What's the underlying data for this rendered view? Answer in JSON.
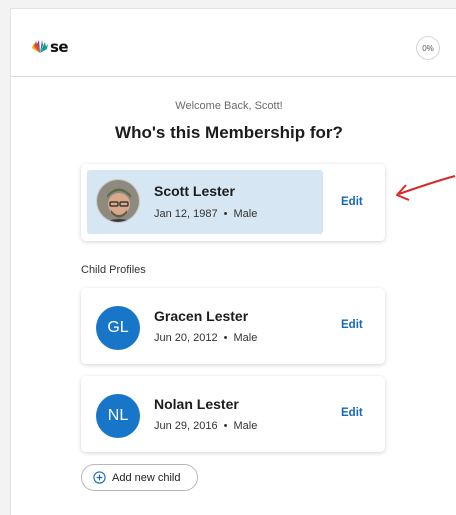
{
  "header": {
    "logo_text": "se",
    "progress": "0%"
  },
  "welcome": "Welcome Back, Scott!",
  "title": "Who's this Membership for?",
  "primary": {
    "name": "Scott Lester",
    "dob": "Jan 12, 1987",
    "sex": "Male",
    "edit_label": "Edit"
  },
  "children_label": "Child Profiles",
  "children": [
    {
      "initials": "GL",
      "name": "Gracen Lester",
      "dob": "Jun 20, 2012",
      "sex": "Male",
      "edit_label": "Edit"
    },
    {
      "initials": "NL",
      "name": "Nolan Lester",
      "dob": "Jun 29, 2016",
      "sex": "Male",
      "edit_label": "Edit"
    }
  ],
  "add_child_label": "Add new child",
  "colors": {
    "accent": "#1668b8",
    "avatar_bg": "#1876c9",
    "selected_bg": "#d6e6f2",
    "annotation": "#d62a2a"
  },
  "dot": "•"
}
